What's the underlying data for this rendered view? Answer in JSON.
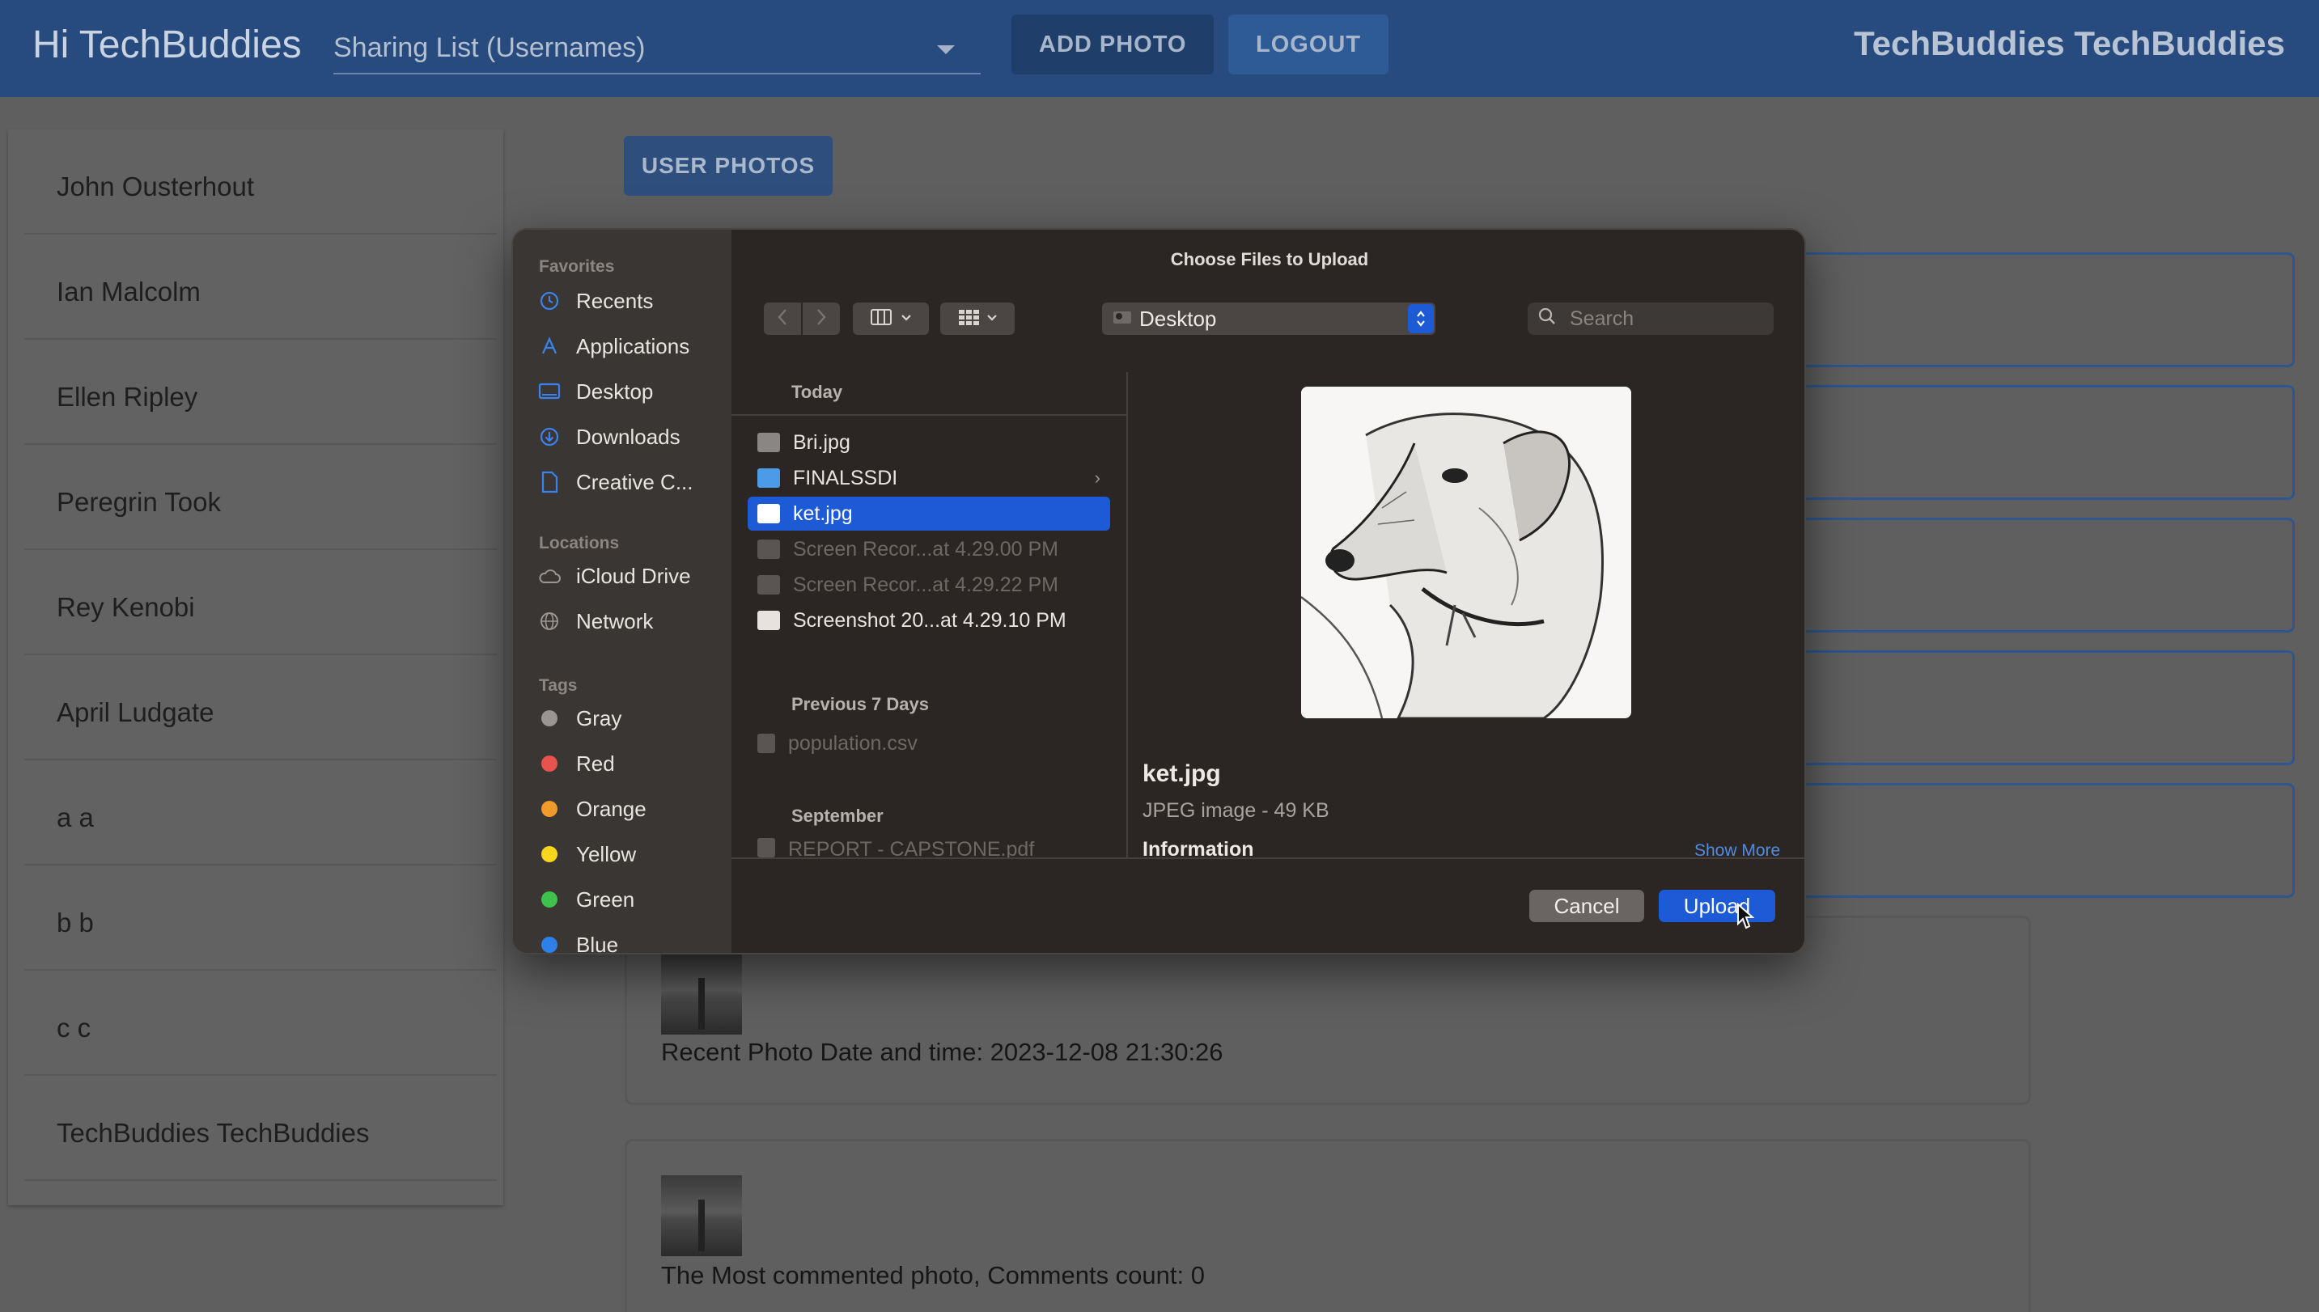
{
  "header": {
    "greeting": "Hi TechBuddies",
    "sharing_placeholder": "Sharing List (Usernames)",
    "add_photo": "ADD PHOTO",
    "logout": "LOGOUT",
    "user_name": "TechBuddies TechBuddies"
  },
  "sidebar": {
    "users": [
      "John Ousterhout",
      "Ian Malcolm",
      "Ellen Ripley",
      "Peregrin Took",
      "Rey Kenobi",
      "April Ludgate",
      "a a",
      "b b",
      "c c",
      "TechBuddies TechBuddies"
    ]
  },
  "main": {
    "user_photos": "USER PHOTOS",
    "cards": [
      "Recent Photo Date and time: 2023-12-08 21:30:26",
      "The Most commented photo, Comments count: 0"
    ]
  },
  "dialog": {
    "title": "Choose Files to Upload",
    "favorites_heading": "Favorites",
    "favorites": [
      "Recents",
      "Applications",
      "Desktop",
      "Downloads",
      "Creative C..."
    ],
    "locations_heading": "Locations",
    "locations": [
      "iCloud Drive",
      "Network"
    ],
    "tags_heading": "Tags",
    "tags": [
      {
        "label": "Gray",
        "color": "#9a9592"
      },
      {
        "label": "Red",
        "color": "#e8534e"
      },
      {
        "label": "Orange",
        "color": "#f09a2a"
      },
      {
        "label": "Yellow",
        "color": "#f5d51d"
      },
      {
        "label": "Green",
        "color": "#3fc24b"
      },
      {
        "label": "Blue",
        "color": "#2f7fe8"
      }
    ],
    "location_popup": "Desktop",
    "search_placeholder": "Search",
    "groups": {
      "today": "Today",
      "prev7": "Previous 7 Days",
      "september": "September"
    },
    "files_today": [
      {
        "name": "Bri.jpg",
        "state": "normal"
      },
      {
        "name": "FINALSSDI",
        "state": "folder"
      },
      {
        "name": "ket.jpg",
        "state": "selected"
      },
      {
        "name": "Screen Recor...at 4.29.00 PM",
        "state": "dim"
      },
      {
        "name": "Screen Recor...at 4.29.22 PM",
        "state": "dim"
      },
      {
        "name": "Screenshot 20...at 4.29.10 PM",
        "state": "normal"
      }
    ],
    "files_prev7": [
      {
        "name": "population.csv",
        "state": "dim"
      }
    ],
    "files_september": [
      {
        "name": "REPORT - CAPSTONE.pdf",
        "state": "dim"
      }
    ],
    "preview": {
      "name": "ket.jpg",
      "kind": "JPEG image - 49 KB",
      "info": "Information",
      "show_more": "Show More"
    },
    "cancel": "Cancel",
    "upload": "Upload"
  }
}
